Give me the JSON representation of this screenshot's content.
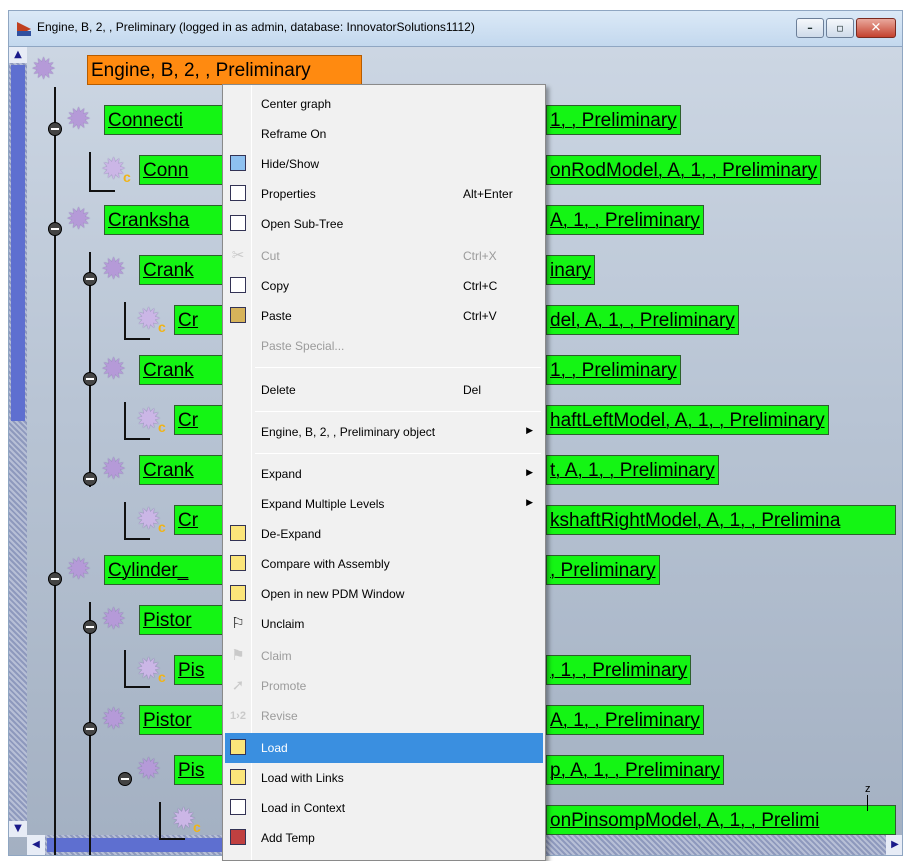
{
  "window": {
    "title": "Engine, B, 2, , Preliminary (logged in as admin, database: InnovatorSolutions1112)",
    "buttons": [
      "–",
      "▫",
      "✕"
    ]
  },
  "tree": {
    "nodes": [
      {
        "label": "Engine, B, 2, , Preliminary"
      },
      {
        "label_left": "Connecti",
        "label_right": "1, , Preliminary"
      },
      {
        "label_left": "Conn",
        "label_right": "onRodModel, A, 1, , Preliminary"
      },
      {
        "label_left": "Cranksha",
        "label_right": "A, 1, , Preliminary"
      },
      {
        "label_left": "Crank",
        "label_right": "inary"
      },
      {
        "label_left": "Cr",
        "label_right": "del, A, 1, , Preliminary"
      },
      {
        "label_left": "Crank",
        "label_right": "1, , Preliminary"
      },
      {
        "label_left": "Cr",
        "label_right": "haftLeftModel, A, 1, , Preliminary"
      },
      {
        "label_left": "Crank",
        "label_right": "t, A, 1, , Preliminary"
      },
      {
        "label_left": "Cr",
        "label_right": "kshaftRightModel, A, 1, , Prelimina"
      },
      {
        "label_left": "Cylinder_",
        "label_right": ", Preliminary"
      },
      {
        "label_left": "Pistor"
      },
      {
        "label_left": "Pis",
        "label_right": ", 1, , Preliminary"
      },
      {
        "label_left": "Pistor",
        "label_right": "A, 1, , Preliminary"
      },
      {
        "label_left": "Pis",
        "label_right": "p, A, 1, , Preliminary"
      },
      {
        "label_right": "onPinsompModel, A, 1, , Prelimi"
      }
    ],
    "axis_label": "z"
  },
  "context_menu": {
    "items": [
      {
        "label": "Center graph",
        "shortcut": "",
        "icon": "none"
      },
      {
        "label": "Reframe On",
        "shortcut": "",
        "icon": "none"
      },
      {
        "label": "Hide/Show",
        "shortcut": "",
        "icon": "hide-show-icon"
      },
      {
        "label": "Properties",
        "shortcut": "Alt+Enter",
        "icon": "properties-icon"
      },
      {
        "label": "Open Sub-Tree",
        "shortcut": "",
        "icon": "subtree-icon"
      },
      {
        "label": "Cut",
        "shortcut": "Ctrl+X",
        "icon": "scissors-icon"
      },
      {
        "label": "Copy",
        "shortcut": "Ctrl+C",
        "icon": "copy-icon"
      },
      {
        "label": "Paste",
        "shortcut": "Ctrl+V",
        "icon": "paste-icon"
      },
      {
        "label": "Paste Special...",
        "shortcut": "",
        "icon": "none"
      },
      {
        "label": "Delete",
        "shortcut": "Del",
        "icon": "none"
      },
      {
        "label": "Engine, B, 2, , Preliminary object",
        "shortcut": "",
        "icon": "none"
      },
      {
        "label": "Expand",
        "shortcut": "",
        "icon": "none"
      },
      {
        "label": "Expand Multiple Levels",
        "shortcut": "",
        "icon": "none"
      },
      {
        "label": "De-Expand",
        "shortcut": "",
        "icon": "de-expand-icon"
      },
      {
        "label": "Compare with Assembly",
        "shortcut": "",
        "icon": "compare-icon"
      },
      {
        "label": "Open in new PDM Window",
        "shortcut": "",
        "icon": "pdm-window-icon"
      },
      {
        "label": "Unclaim",
        "shortcut": "",
        "icon": "unclaim-flag-icon"
      },
      {
        "label": "Claim",
        "shortcut": "",
        "icon": "claim-flag-icon"
      },
      {
        "label": "Promote",
        "shortcut": "",
        "icon": "promote-arrow-icon"
      },
      {
        "label": "Revise",
        "shortcut": "",
        "icon": "revise-icon"
      },
      {
        "label": "Load",
        "shortcut": "",
        "icon": "load-icon"
      },
      {
        "label": "Load with Links",
        "shortcut": "",
        "icon": "load-links-icon"
      },
      {
        "label": "Load in Context",
        "shortcut": "",
        "icon": "load-context-icon"
      },
      {
        "label": "Add Temp",
        "shortcut": "",
        "icon": "add-temp-icon"
      }
    ]
  },
  "colors": {
    "node_fill": "#14f514",
    "root_fill": "#ff8a10",
    "menu_highlight": "#3a8fe0"
  }
}
